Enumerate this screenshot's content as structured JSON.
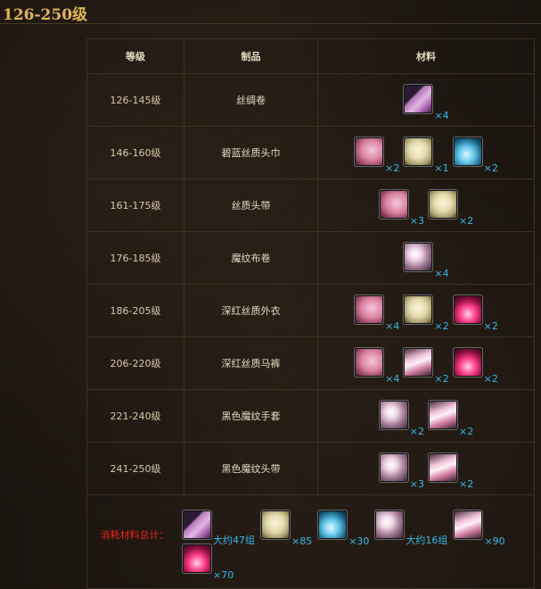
{
  "heading": "126-250级",
  "table": {
    "headers": [
      "等级",
      "制品",
      "材料"
    ],
    "rows": [
      {
        "level": "126-145级",
        "product": "丝绸卷",
        "materials": [
          {
            "icon": "silk-roll-icon",
            "count": "×4"
          }
        ]
      },
      {
        "level": "146-160级",
        "product": "碧蓝丝质头巾",
        "materials": [
          {
            "icon": "silk-cloth-icon",
            "count": "×2"
          },
          {
            "icon": "wool-bundle-icon",
            "count": "×1"
          },
          {
            "icon": "blue-dye-icon",
            "count": "×2"
          }
        ]
      },
      {
        "level": "161-175级",
        "product": "丝质头带",
        "materials": [
          {
            "icon": "silk-cloth-icon",
            "count": "×3"
          },
          {
            "icon": "wool-bundle-icon",
            "count": "×2"
          }
        ]
      },
      {
        "level": "176-185级",
        "product": "魔纹布卷",
        "materials": [
          {
            "icon": "magic-cloth-icon",
            "count": "×4"
          }
        ]
      },
      {
        "level": "186-205级",
        "product": "深红丝质外衣",
        "materials": [
          {
            "icon": "silk-cloth-icon",
            "count": "×4"
          },
          {
            "icon": "wool-bundle-icon",
            "count": "×2"
          },
          {
            "icon": "red-dye-icon",
            "count": "×2"
          }
        ]
      },
      {
        "level": "206-220级",
        "product": "深红丝质马裤",
        "materials": [
          {
            "icon": "silk-cloth-icon",
            "count": "×4"
          },
          {
            "icon": "silk-bolt-icon",
            "count": "×2"
          },
          {
            "icon": "red-dye-icon",
            "count": "×2"
          }
        ]
      },
      {
        "level": "221-240级",
        "product": "黑色魔纹手套",
        "materials": [
          {
            "icon": "magic-cloth-icon",
            "count": "×2"
          },
          {
            "icon": "silk-bolt-icon",
            "count": "×2"
          }
        ]
      },
      {
        "level": "241-250级",
        "product": "黑色魔纹头带",
        "materials": [
          {
            "icon": "magic-cloth-icon",
            "count": "×3"
          },
          {
            "icon": "silk-bolt-icon",
            "count": "×2"
          }
        ]
      }
    ],
    "totals": {
      "label": "消耗材料总计：",
      "items": [
        {
          "icon": "silk-roll-icon",
          "count": "大约47组"
        },
        {
          "icon": "wool-bundle-icon",
          "count": "×85"
        },
        {
          "icon": "blue-dye-icon",
          "count": "×30"
        },
        {
          "icon": "magic-cloth-icon",
          "count": "大约16组"
        },
        {
          "icon": "silk-bolt-icon",
          "count": "×90"
        },
        {
          "icon": "red-dye-icon",
          "count": "×70"
        }
      ]
    }
  },
  "colors": {
    "heading": "#e0b45a",
    "count": "#34b8e8",
    "totals_label": "#e8241c",
    "border": "#3e3022"
  }
}
